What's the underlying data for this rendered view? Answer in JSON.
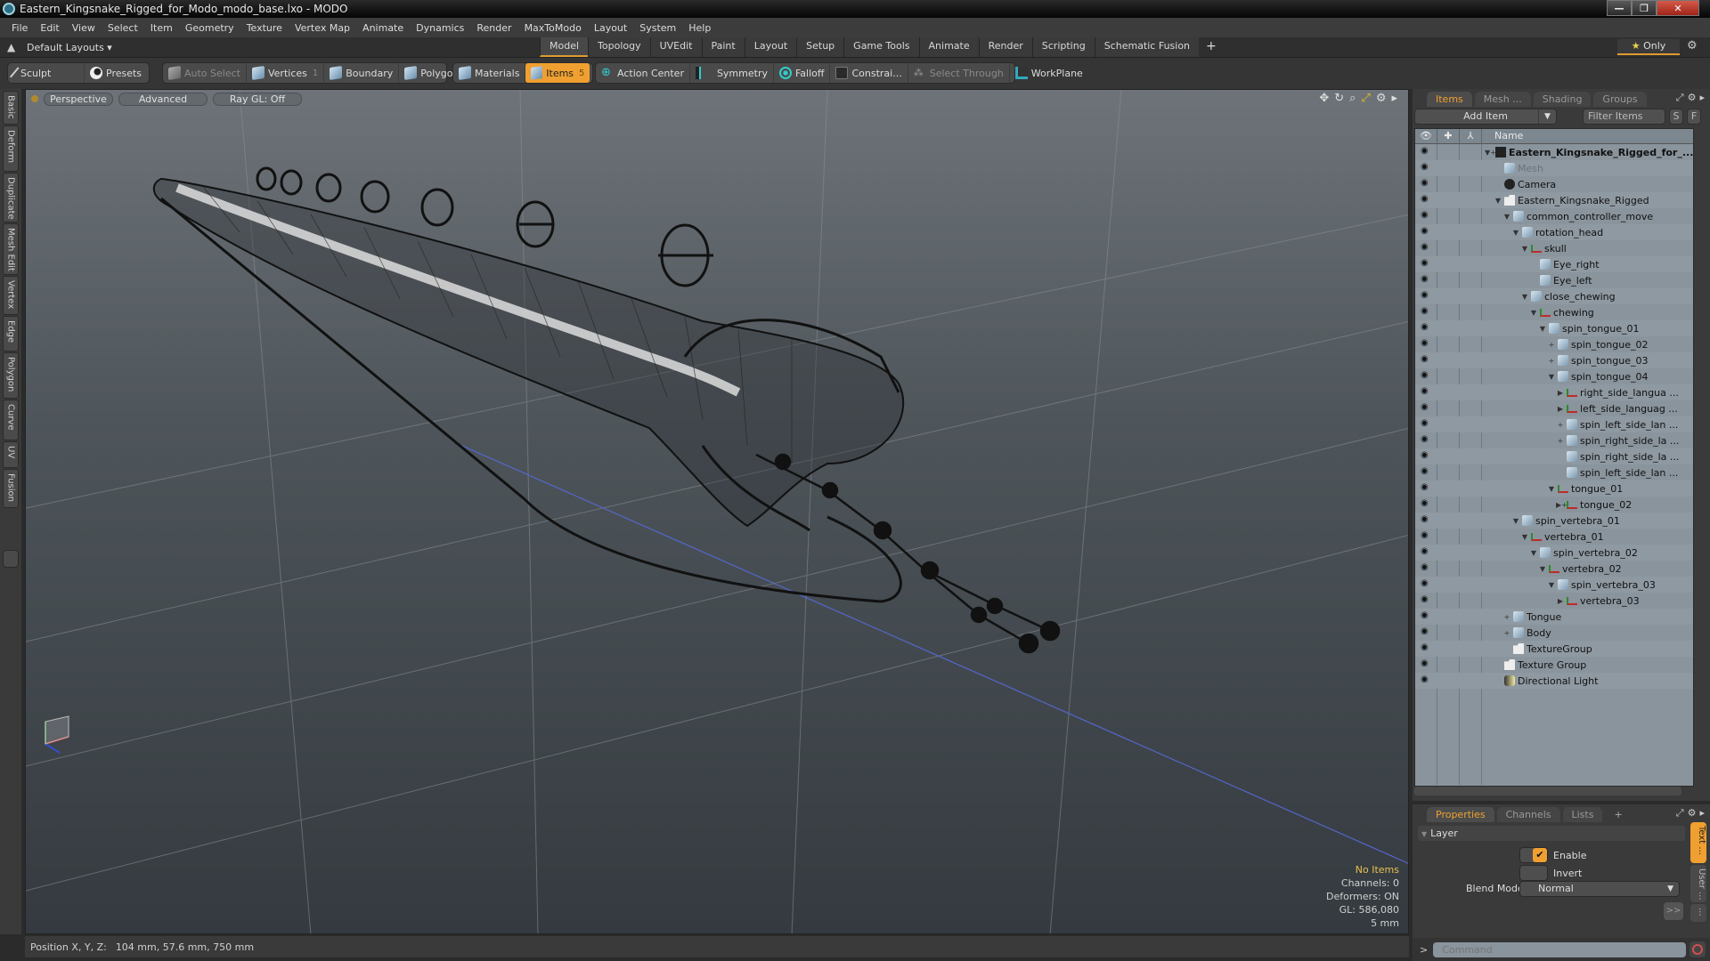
{
  "window": {
    "title": "Eastern_Kingsnake_Rigged_for_Modo_modo_base.lxo - MODO"
  },
  "menu": [
    "File",
    "Edit",
    "View",
    "Select",
    "Item",
    "Geometry",
    "Texture",
    "Vertex Map",
    "Animate",
    "Dynamics",
    "Render",
    "MaxToModo",
    "Layout",
    "System",
    "Help"
  ],
  "layout": {
    "default_layouts": "Default Layouts ▾",
    "mode_tabs": [
      "Model",
      "Topology",
      "UVEdit",
      "Paint",
      "Layout",
      "Setup",
      "Game Tools",
      "Animate",
      "Render",
      "Scripting",
      "Schematic Fusion"
    ],
    "active_tab": "Model",
    "only_label": "Only"
  },
  "toolbar": {
    "sculpt": "Sculpt",
    "presets": "Presets",
    "auto_select": "Auto Select",
    "vertices": "Vertices",
    "vertices_count": "1",
    "boundary": "Boundary",
    "polygons": "Polygons",
    "materials": "Materials",
    "items": "Items",
    "items_count": "5",
    "action_center": "Action Center",
    "symmetry": "Symmetry",
    "falloff": "Falloff",
    "constraints": "Constrai...",
    "select_through": "Select Through",
    "workplane": "WorkPlane"
  },
  "side_tabs": [
    "Basic",
    "Deform",
    "Duplicate",
    "Mesh Edit",
    "Vertex",
    "Edge",
    "Polygon",
    "Curve",
    "UV",
    "Fusion"
  ],
  "viewport": {
    "view_mode": "Perspective",
    "shading": "Advanced",
    "raygl": "Ray GL: Off",
    "info": {
      "selection": "No Items",
      "channels": "Channels: 0",
      "deformers": "Deformers: ON",
      "gl": "GL: 586,080",
      "units": "5 mm"
    }
  },
  "status": {
    "label": "Position X, Y, Z:",
    "value": "104 mm, 57.6 mm, 750 mm"
  },
  "items_panel": {
    "tabs": [
      "Items",
      "Mesh ...",
      "Shading",
      "Groups"
    ],
    "active_tab": "Items",
    "add_item": "Add Item",
    "filter_placeholder": "Filter Items",
    "s_btn": "S",
    "f_btn": "F",
    "name_header": "Name",
    "tree": [
      {
        "name": "Eastern_Kingsnake_Rigged_for_...",
        "depth": 0,
        "icon": "scene",
        "exp": "▼+",
        "bold": true
      },
      {
        "name": "Mesh",
        "depth": 1,
        "icon": "mesh",
        "exp": "",
        "grey": true
      },
      {
        "name": "Camera",
        "depth": 1,
        "icon": "cam",
        "exp": ""
      },
      {
        "name": "Eastern_Kingsnake_Rigged",
        "depth": 1,
        "icon": "folder",
        "exp": "▼"
      },
      {
        "name": "common_controller_move",
        "depth": 2,
        "icon": "mesh",
        "exp": "▼"
      },
      {
        "name": "rotation_head",
        "depth": 3,
        "icon": "mesh",
        "exp": "▼"
      },
      {
        "name": "skull",
        "depth": 4,
        "icon": "loc",
        "exp": "▼"
      },
      {
        "name": "Eye_right",
        "depth": 5,
        "icon": "mesh",
        "exp": ""
      },
      {
        "name": "Eye_left",
        "depth": 5,
        "icon": "mesh",
        "exp": ""
      },
      {
        "name": "close_chewing",
        "depth": 4,
        "icon": "mesh",
        "exp": "▼"
      },
      {
        "name": "chewing",
        "depth": 5,
        "icon": "loc",
        "exp": "▼"
      },
      {
        "name": "spin_tongue_01",
        "depth": 6,
        "icon": "mesh",
        "exp": "▼"
      },
      {
        "name": "spin_tongue_02",
        "depth": 7,
        "icon": "mesh",
        "exp": "+"
      },
      {
        "name": "spin_tongue_03",
        "depth": 7,
        "icon": "mesh",
        "exp": "+"
      },
      {
        "name": "spin_tongue_04",
        "depth": 7,
        "icon": "mesh",
        "exp": "▼"
      },
      {
        "name": "right_side_langua ...",
        "depth": 8,
        "icon": "loc",
        "exp": "▶"
      },
      {
        "name": "left_side_languag ...",
        "depth": 8,
        "icon": "loc",
        "exp": "▶"
      },
      {
        "name": "spin_left_side_lan ...",
        "depth": 8,
        "icon": "mesh",
        "exp": "+"
      },
      {
        "name": "spin_right_side_la ...",
        "depth": 8,
        "icon": "mesh",
        "exp": "+"
      },
      {
        "name": "spin_right_side_la ...",
        "depth": 8,
        "icon": "mesh",
        "exp": ""
      },
      {
        "name": "spin_left_side_lan ...",
        "depth": 8,
        "icon": "mesh",
        "exp": ""
      },
      {
        "name": "tongue_01",
        "depth": 7,
        "icon": "loc",
        "exp": "▼"
      },
      {
        "name": "tongue_02",
        "depth": 8,
        "icon": "loc",
        "exp": "▶+"
      },
      {
        "name": "spin_vertebra_01",
        "depth": 3,
        "icon": "mesh",
        "exp": "▼"
      },
      {
        "name": "vertebra_01",
        "depth": 4,
        "icon": "loc",
        "exp": "▼"
      },
      {
        "name": "spin_vertebra_02",
        "depth": 5,
        "icon": "mesh",
        "exp": "▼"
      },
      {
        "name": "vertebra_02",
        "depth": 6,
        "icon": "loc",
        "exp": "▼"
      },
      {
        "name": "spin_vertebra_03",
        "depth": 7,
        "icon": "mesh",
        "exp": "▼"
      },
      {
        "name": "vertebra_03",
        "depth": 8,
        "icon": "loc",
        "exp": "▶"
      },
      {
        "name": "Tongue",
        "depth": 2,
        "icon": "mesh",
        "exp": "+"
      },
      {
        "name": "Body",
        "depth": 2,
        "icon": "mesh",
        "exp": "+"
      },
      {
        "name": "TextureGroup",
        "depth": 2,
        "icon": "folder",
        "exp": ""
      },
      {
        "name": "Texture Group",
        "depth": 1,
        "icon": "folder",
        "exp": ""
      },
      {
        "name": "Directional Light",
        "depth": 1,
        "icon": "light",
        "exp": ""
      }
    ]
  },
  "properties_panel": {
    "tabs": [
      "Properties",
      "Channels",
      "Lists"
    ],
    "active_tab": "Properties",
    "section": "Layer",
    "enable_label": "Enable",
    "enable_checked": true,
    "invert_label": "Invert",
    "invert_checked": false,
    "blend_mode_label": "Blend Mode",
    "blend_mode_value": "Normal",
    "more_btn": ">>",
    "side_tabs": [
      "Text ...",
      "User ...",
      "..."
    ]
  },
  "command": {
    "prompt": ">",
    "placeholder": "Command"
  },
  "colors": {
    "accent": "#f0a030",
    "viewport_top": "#6d7378",
    "viewport_bottom": "#343a3f"
  }
}
